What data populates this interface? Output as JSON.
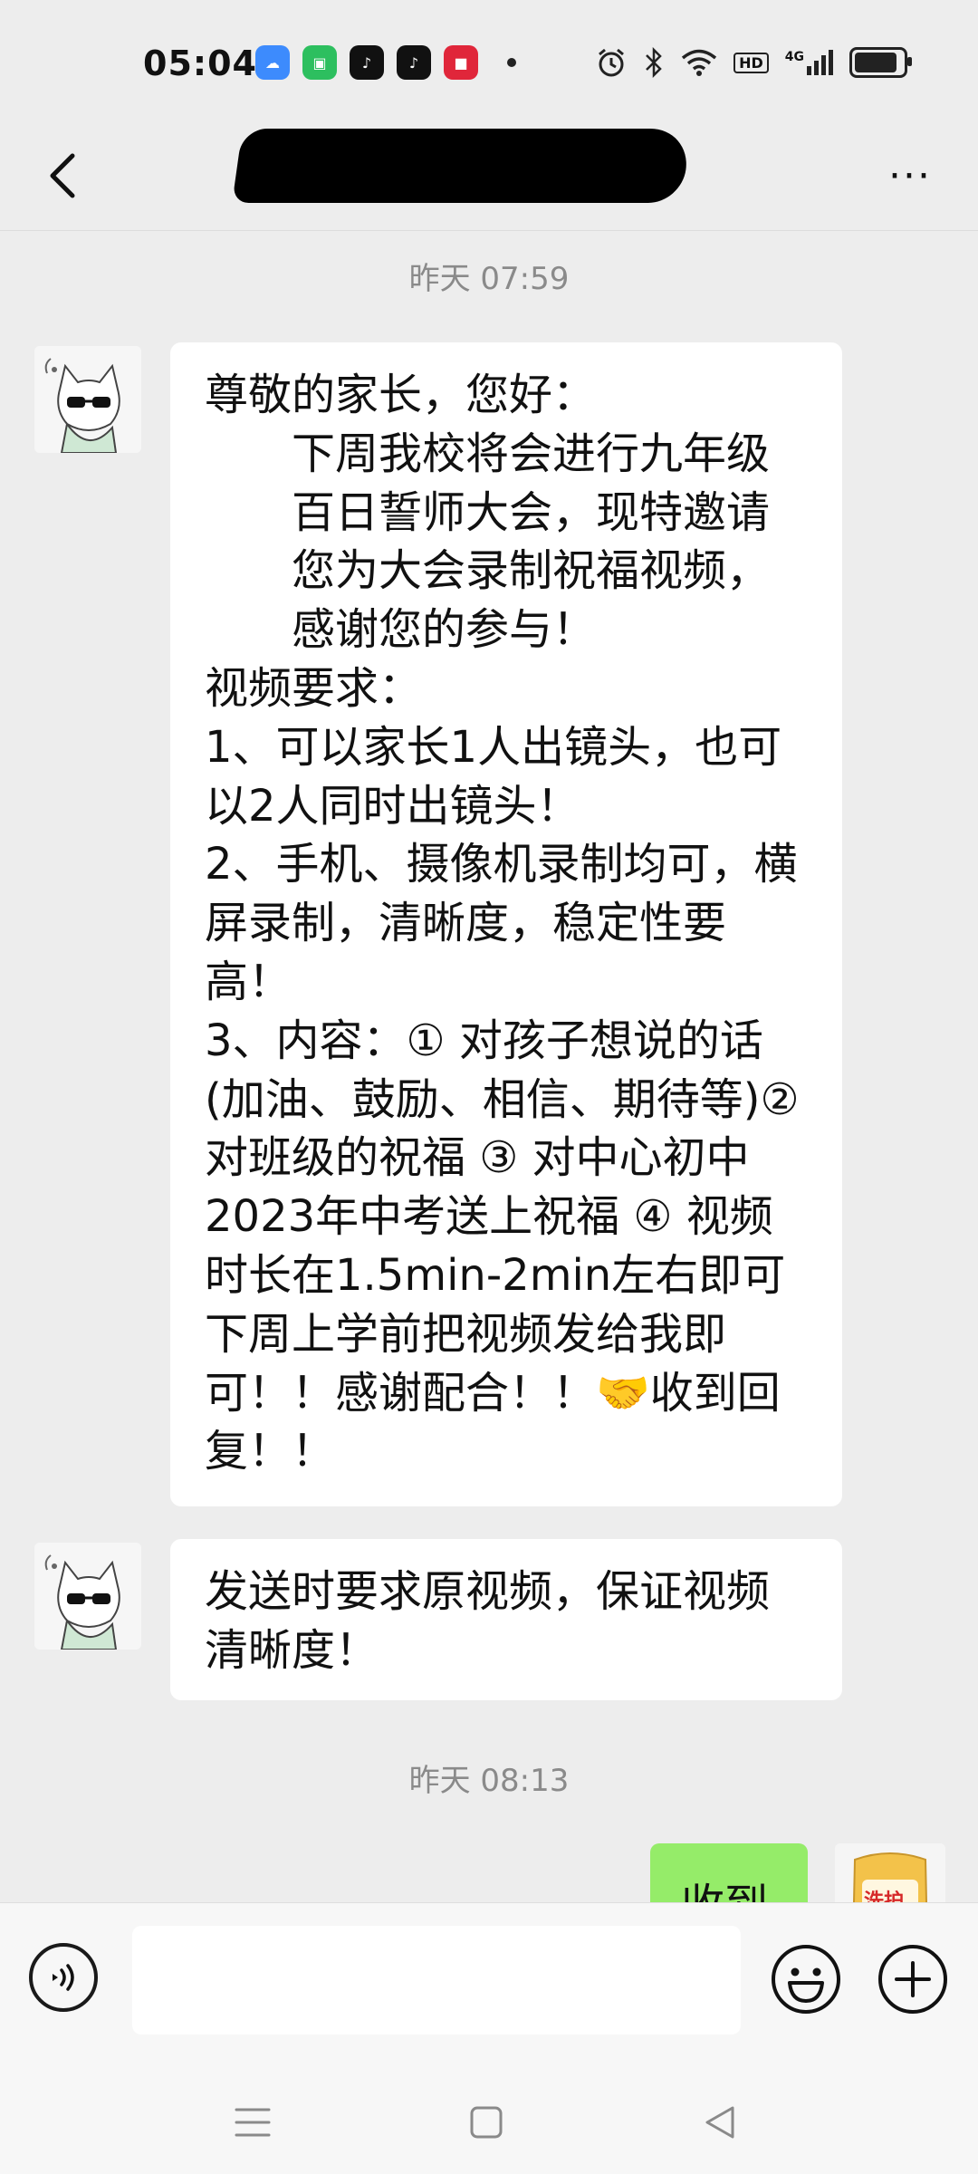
{
  "status_bar": {
    "time": "05:04",
    "app_icons": [
      {
        "name": "cloud-app-icon",
        "color": "#3d8bfd",
        "glyph": "☁"
      },
      {
        "name": "shopping-app-icon",
        "color": "#2dbf5f",
        "glyph": "▣"
      },
      {
        "name": "douyin-lite-icon",
        "color": "#111111",
        "glyph": "♪"
      },
      {
        "name": "douyin-icon",
        "color": "#111111",
        "glyph": "♪"
      },
      {
        "name": "news-app-icon",
        "color": "#e0263a",
        "glyph": "■"
      }
    ],
    "hd_label": "HD",
    "network_label": "4G",
    "battery_level": 0.95
  },
  "header": {
    "back_icon": "chevron-left-icon",
    "more_icon": "more-dots-icon",
    "more_glyph": "···"
  },
  "messages": {
    "timestamp1": "昨天 07:59",
    "msg1_lines": [
      "尊敬的家长，您好：",
      "下周我校将会进行九年级百日誓师大会，现特邀请您为大会录制祝福视频，感谢您的参与！",
      "视频要求：",
      "1、可以家长1人出镜头，也可以2人同时出镜头！",
      "2、手机、摄像机录制均可，横屏录制，清晰度，稳定性要高！",
      "3、内容：① 对孩子想说的话(加油、鼓励、相信、期待等)② 对班级的祝福 ③ 对中心初中2023年中考送上祝福 ④ 视频时长在1.5min-2min左右即可",
      "下周上学前把视频发给我即可！！感谢配合！！🤝收到回复！！"
    ],
    "msg2": "发送时要求原视频，保证视频清晰度！",
    "timestamp2": "昨天 08:13",
    "own_reply": "收到",
    "own_avatar_text": "洗护"
  },
  "input_bar": {
    "voice_icon": "voice-icon",
    "emoji_icon": "emoji-icon",
    "plus_icon": "plus-icon",
    "placeholder": ""
  },
  "colors": {
    "background": "#ededed",
    "bubble_other": "#ffffff",
    "bubble_self": "#95ec69"
  }
}
